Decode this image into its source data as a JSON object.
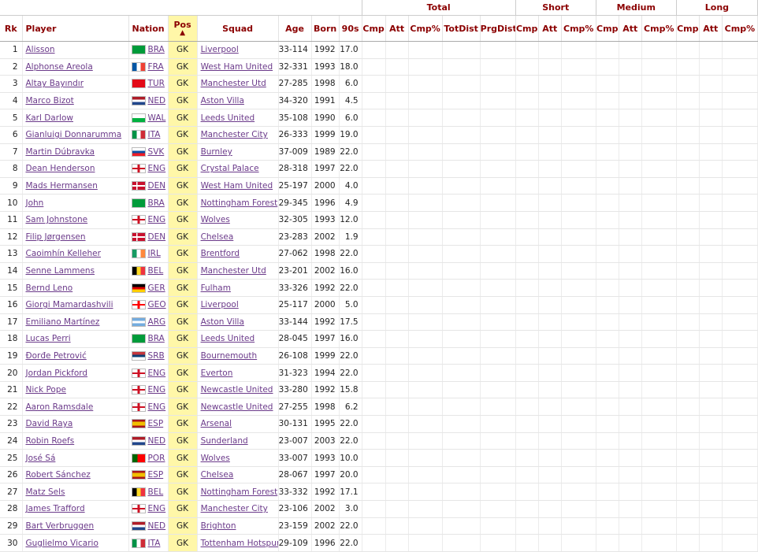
{
  "groups": {
    "total": "Total",
    "short": "Short",
    "medium": "Medium",
    "long": "Long"
  },
  "headers": {
    "rk": "Rk",
    "player": "Player",
    "nation": "Nation",
    "pos": "Pos",
    "pos_arrow": "▲",
    "squad": "Squad",
    "age": "Age",
    "born": "Born",
    "nineties": "90s",
    "total": [
      "Cmp",
      "Att",
      "Cmp%",
      "TotDist",
      "PrgDist"
    ],
    "short": [
      "Cmp",
      "Att",
      "Cmp%"
    ],
    "medium": [
      "Cmp",
      "Att",
      "Cmp%"
    ],
    "long": [
      "Cmp",
      "Att",
      "Cmp%"
    ]
  },
  "rows": [
    {
      "rk": "1",
      "player": "Alisson",
      "nation": "BRA",
      "pos": "GK",
      "squad": "Liverpool",
      "age": "33-114",
      "born": "1992",
      "nineties": "17.0"
    },
    {
      "rk": "2",
      "player": "Alphonse Areola",
      "nation": "FRA",
      "pos": "GK",
      "squad": "West Ham United",
      "age": "32-331",
      "born": "1993",
      "nineties": "18.0"
    },
    {
      "rk": "3",
      "player": "Altay Bayındır",
      "nation": "TUR",
      "pos": "GK",
      "squad": "Manchester Utd",
      "age": "27-285",
      "born": "1998",
      "nineties": "6.0"
    },
    {
      "rk": "4",
      "player": "Marco Bizot",
      "nation": "NED",
      "pos": "GK",
      "squad": "Aston Villa",
      "age": "34-320",
      "born": "1991",
      "nineties": "4.5"
    },
    {
      "rk": "5",
      "player": "Karl Darlow",
      "nation": "WAL",
      "pos": "GK",
      "squad": "Leeds United",
      "age": "35-108",
      "born": "1990",
      "nineties": "6.0"
    },
    {
      "rk": "6",
      "player": "Gianluigi Donnarumma",
      "nation": "ITA",
      "pos": "GK",
      "squad": "Manchester City",
      "age": "26-333",
      "born": "1999",
      "nineties": "19.0"
    },
    {
      "rk": "7",
      "player": "Martin Dúbravka",
      "nation": "SVK",
      "pos": "GK",
      "squad": "Burnley",
      "age": "37-009",
      "born": "1989",
      "nineties": "22.0"
    },
    {
      "rk": "8",
      "player": "Dean Henderson",
      "nation": "ENG",
      "pos": "GK",
      "squad": "Crystal Palace",
      "age": "28-318",
      "born": "1997",
      "nineties": "22.0"
    },
    {
      "rk": "9",
      "player": "Mads Hermansen",
      "nation": "DEN",
      "pos": "GK",
      "squad": "West Ham United",
      "age": "25-197",
      "born": "2000",
      "nineties": "4.0"
    },
    {
      "rk": "10",
      "player": "John",
      "nation": "BRA",
      "pos": "GK",
      "squad": "Nottingham Forest",
      "age": "29-345",
      "born": "1996",
      "nineties": "4.9"
    },
    {
      "rk": "11",
      "player": "Sam Johnstone",
      "nation": "ENG",
      "pos": "GK",
      "squad": "Wolves",
      "age": "32-305",
      "born": "1993",
      "nineties": "12.0"
    },
    {
      "rk": "12",
      "player": "Filip Jørgensen",
      "nation": "DEN",
      "pos": "GK",
      "squad": "Chelsea",
      "age": "23-283",
      "born": "2002",
      "nineties": "1.9"
    },
    {
      "rk": "13",
      "player": "Caoimhín Kelleher",
      "nation": "IRL",
      "pos": "GK",
      "squad": "Brentford",
      "age": "27-062",
      "born": "1998",
      "nineties": "22.0"
    },
    {
      "rk": "14",
      "player": "Senne Lammens",
      "nation": "BEL",
      "pos": "GK",
      "squad": "Manchester Utd",
      "age": "23-201",
      "born": "2002",
      "nineties": "16.0"
    },
    {
      "rk": "15",
      "player": "Bernd Leno",
      "nation": "GER",
      "pos": "GK",
      "squad": "Fulham",
      "age": "33-326",
      "born": "1992",
      "nineties": "22.0"
    },
    {
      "rk": "16",
      "player": "Giorgi Mamardashvili",
      "nation": "GEO",
      "pos": "GK",
      "squad": "Liverpool",
      "age": "25-117",
      "born": "2000",
      "nineties": "5.0"
    },
    {
      "rk": "17",
      "player": "Emiliano Martínez",
      "nation": "ARG",
      "pos": "GK",
      "squad": "Aston Villa",
      "age": "33-144",
      "born": "1992",
      "nineties": "17.5"
    },
    {
      "rk": "18",
      "player": "Lucas Perri",
      "nation": "BRA",
      "pos": "GK",
      "squad": "Leeds United",
      "age": "28-045",
      "born": "1997",
      "nineties": "16.0"
    },
    {
      "rk": "19",
      "player": "Đorđe Petrović",
      "nation": "SRB",
      "pos": "GK",
      "squad": "Bournemouth",
      "age": "26-108",
      "born": "1999",
      "nineties": "22.0"
    },
    {
      "rk": "20",
      "player": "Jordan Pickford",
      "nation": "ENG",
      "pos": "GK",
      "squad": "Everton",
      "age": "31-323",
      "born": "1994",
      "nineties": "22.0"
    },
    {
      "rk": "21",
      "player": "Nick Pope",
      "nation": "ENG",
      "pos": "GK",
      "squad": "Newcastle United",
      "age": "33-280",
      "born": "1992",
      "nineties": "15.8"
    },
    {
      "rk": "22",
      "player": "Aaron Ramsdale",
      "nation": "ENG",
      "pos": "GK",
      "squad": "Newcastle United",
      "age": "27-255",
      "born": "1998",
      "nineties": "6.2"
    },
    {
      "rk": "23",
      "player": "David Raya",
      "nation": "ESP",
      "pos": "GK",
      "squad": "Arsenal",
      "age": "30-131",
      "born": "1995",
      "nineties": "22.0"
    },
    {
      "rk": "24",
      "player": "Robin Roefs",
      "nation": "NED",
      "pos": "GK",
      "squad": "Sunderland",
      "age": "23-007",
      "born": "2003",
      "nineties": "22.0"
    },
    {
      "rk": "25",
      "player": "José Sá",
      "nation": "POR",
      "pos": "GK",
      "squad": "Wolves",
      "age": "33-007",
      "born": "1993",
      "nineties": "10.0"
    },
    {
      "rk": "26",
      "player": "Robert Sánchez",
      "nation": "ESP",
      "pos": "GK",
      "squad": "Chelsea",
      "age": "28-067",
      "born": "1997",
      "nineties": "20.0"
    },
    {
      "rk": "27",
      "player": "Matz Sels",
      "nation": "BEL",
      "pos": "GK",
      "squad": "Nottingham Forest",
      "age": "33-332",
      "born": "1992",
      "nineties": "17.1"
    },
    {
      "rk": "28",
      "player": "James Trafford",
      "nation": "ENG",
      "pos": "GK",
      "squad": "Manchester City",
      "age": "23-106",
      "born": "2002",
      "nineties": "3.0"
    },
    {
      "rk": "29",
      "player": "Bart Verbruggen",
      "nation": "NED",
      "pos": "GK",
      "squad": "Brighton",
      "age": "23-159",
      "born": "2002",
      "nineties": "22.0"
    },
    {
      "rk": "30",
      "player": "Guglielmo Vicario",
      "nation": "ITA",
      "pos": "GK",
      "squad": "Tottenham Hotspur",
      "age": "29-109",
      "born": "1996",
      "nineties": "22.0"
    }
  ],
  "flags": {
    "BRA": "linear-gradient(#009b3a,#009b3a)",
    "FRA": "linear-gradient(90deg,#0055a4 33%,#fff 33% 66%,#ef4135 66%)",
    "TUR": "linear-gradient(#e30a17,#e30a17)",
    "NED": "linear-gradient(#ae1c28 33%,#fff 33% 66%,#21468b 66%)",
    "WAL": "linear-gradient(#fff 50%,#00b140 50%)",
    "ITA": "linear-gradient(90deg,#009246 33%,#fff 33% 66%,#ce2b37 66%)",
    "SVK": "linear-gradient(#fff 33%,#0b4ea2 33% 66%,#ee1c25 66%)",
    "ENG": "linear-gradient(90deg,transparent 42%,#ce1124 42% 58%,transparent 58%),linear-gradient(transparent 38%,#ce1124 38% 62%,#fff 62%)",
    "DEN": "linear-gradient(90deg,transparent 30%,#fff 30% 42%,transparent 42%),linear-gradient(#c8102e 42%,#fff 42% 58%,#c8102e 58%)",
    "IRL": "linear-gradient(90deg,#169b62 33%,#fff 33% 66%,#ff883e 66%)",
    "BEL": "linear-gradient(90deg,#000 33%,#fdda24 33% 66%,#ef3340 66%)",
    "GER": "linear-gradient(#000 33%,#dd0000 33% 66%,#ffce00 66%)",
    "GEO": "linear-gradient(90deg,transparent 42%,#ff0000 42% 58%,transparent 58%),linear-gradient(#fff 38%,#ff0000 38% 62%,#fff 62%)",
    "ARG": "linear-gradient(#74acdf 33%,#fff 33% 66%,#74acdf 66%)",
    "SRB": "linear-gradient(#c6363c 33%,#0c4076 33% 66%,#fff 66%)",
    "ESP": "linear-gradient(#aa151b 25%,#f1bf00 25% 75%,#aa151b 75%)",
    "POR": "linear-gradient(90deg,#006600 40%,#ff0000 40%)"
  }
}
